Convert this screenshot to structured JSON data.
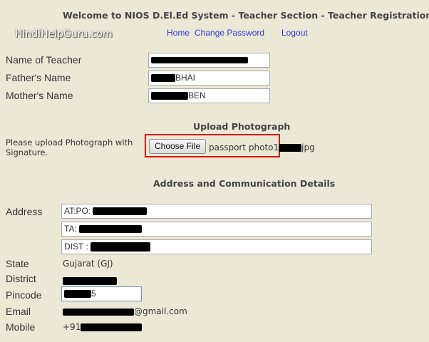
{
  "header": {
    "title": "Welcome to NIOS D.El.Ed System - Teacher Section - Teacher Registration",
    "watermark": "HindiHelpGuru.com"
  },
  "nav": {
    "home": "Home",
    "change_password": "Change Password",
    "logout": "Logout"
  },
  "personal": {
    "teacher_label": "Name of Teacher",
    "father_label": "Father's Name",
    "father_suffix": "BHAI",
    "mother_label": "Mother's Name",
    "mother_suffix": "BEN"
  },
  "photo": {
    "section_title": "Upload Photograph",
    "instruction": "Please upload Photograph with Signature.",
    "choose_file": "Choose File",
    "file_prefix": "passport photo1",
    "file_suffix": "jpg"
  },
  "address": {
    "section_title": "Address and Communication Details",
    "address_label": "Address",
    "line1_prefix": "AT:PO:",
    "line2_prefix": "TA:",
    "line3_prefix": "DIST :",
    "state_label": "State",
    "state_value": "Gujarat (GJ)",
    "district_label": "District",
    "pincode_label": "Pincode",
    "pincode_suffix": "5",
    "email_label": "Email",
    "email_suffix": "@gmail.com",
    "mobile_label": "Mobile",
    "mobile_prefix": "+91"
  },
  "colors": {
    "background": "#ece8d6",
    "link": "#2e3cd6",
    "highlight": "#e01010"
  }
}
